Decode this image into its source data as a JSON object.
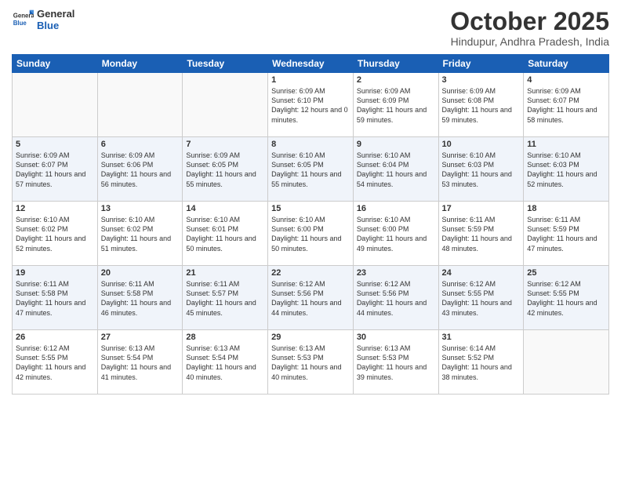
{
  "header": {
    "logo_general": "General",
    "logo_blue": "Blue",
    "month_title": "October 2025",
    "location": "Hindupur, Andhra Pradesh, India"
  },
  "calendar": {
    "days_of_week": [
      "Sunday",
      "Monday",
      "Tuesday",
      "Wednesday",
      "Thursday",
      "Friday",
      "Saturday"
    ],
    "weeks": [
      [
        {
          "date": "",
          "sunrise": "",
          "sunset": "",
          "daylight": ""
        },
        {
          "date": "",
          "sunrise": "",
          "sunset": "",
          "daylight": ""
        },
        {
          "date": "",
          "sunrise": "",
          "sunset": "",
          "daylight": ""
        },
        {
          "date": "1",
          "sunrise": "Sunrise: 6:09 AM",
          "sunset": "Sunset: 6:10 PM",
          "daylight": "Daylight: 12 hours and 0 minutes."
        },
        {
          "date": "2",
          "sunrise": "Sunrise: 6:09 AM",
          "sunset": "Sunset: 6:09 PM",
          "daylight": "Daylight: 11 hours and 59 minutes."
        },
        {
          "date": "3",
          "sunrise": "Sunrise: 6:09 AM",
          "sunset": "Sunset: 6:08 PM",
          "daylight": "Daylight: 11 hours and 59 minutes."
        },
        {
          "date": "4",
          "sunrise": "Sunrise: 6:09 AM",
          "sunset": "Sunset: 6:07 PM",
          "daylight": "Daylight: 11 hours and 58 minutes."
        }
      ],
      [
        {
          "date": "5",
          "sunrise": "Sunrise: 6:09 AM",
          "sunset": "Sunset: 6:07 PM",
          "daylight": "Daylight: 11 hours and 57 minutes."
        },
        {
          "date": "6",
          "sunrise": "Sunrise: 6:09 AM",
          "sunset": "Sunset: 6:06 PM",
          "daylight": "Daylight: 11 hours and 56 minutes."
        },
        {
          "date": "7",
          "sunrise": "Sunrise: 6:09 AM",
          "sunset": "Sunset: 6:05 PM",
          "daylight": "Daylight: 11 hours and 55 minutes."
        },
        {
          "date": "8",
          "sunrise": "Sunrise: 6:10 AM",
          "sunset": "Sunset: 6:05 PM",
          "daylight": "Daylight: 11 hours and 55 minutes."
        },
        {
          "date": "9",
          "sunrise": "Sunrise: 6:10 AM",
          "sunset": "Sunset: 6:04 PM",
          "daylight": "Daylight: 11 hours and 54 minutes."
        },
        {
          "date": "10",
          "sunrise": "Sunrise: 6:10 AM",
          "sunset": "Sunset: 6:03 PM",
          "daylight": "Daylight: 11 hours and 53 minutes."
        },
        {
          "date": "11",
          "sunrise": "Sunrise: 6:10 AM",
          "sunset": "Sunset: 6:03 PM",
          "daylight": "Daylight: 11 hours and 52 minutes."
        }
      ],
      [
        {
          "date": "12",
          "sunrise": "Sunrise: 6:10 AM",
          "sunset": "Sunset: 6:02 PM",
          "daylight": "Daylight: 11 hours and 52 minutes."
        },
        {
          "date": "13",
          "sunrise": "Sunrise: 6:10 AM",
          "sunset": "Sunset: 6:02 PM",
          "daylight": "Daylight: 11 hours and 51 minutes."
        },
        {
          "date": "14",
          "sunrise": "Sunrise: 6:10 AM",
          "sunset": "Sunset: 6:01 PM",
          "daylight": "Daylight: 11 hours and 50 minutes."
        },
        {
          "date": "15",
          "sunrise": "Sunrise: 6:10 AM",
          "sunset": "Sunset: 6:00 PM",
          "daylight": "Daylight: 11 hours and 50 minutes."
        },
        {
          "date": "16",
          "sunrise": "Sunrise: 6:10 AM",
          "sunset": "Sunset: 6:00 PM",
          "daylight": "Daylight: 11 hours and 49 minutes."
        },
        {
          "date": "17",
          "sunrise": "Sunrise: 6:11 AM",
          "sunset": "Sunset: 5:59 PM",
          "daylight": "Daylight: 11 hours and 48 minutes."
        },
        {
          "date": "18",
          "sunrise": "Sunrise: 6:11 AM",
          "sunset": "Sunset: 5:59 PM",
          "daylight": "Daylight: 11 hours and 47 minutes."
        }
      ],
      [
        {
          "date": "19",
          "sunrise": "Sunrise: 6:11 AM",
          "sunset": "Sunset: 5:58 PM",
          "daylight": "Daylight: 11 hours and 47 minutes."
        },
        {
          "date": "20",
          "sunrise": "Sunrise: 6:11 AM",
          "sunset": "Sunset: 5:58 PM",
          "daylight": "Daylight: 11 hours and 46 minutes."
        },
        {
          "date": "21",
          "sunrise": "Sunrise: 6:11 AM",
          "sunset": "Sunset: 5:57 PM",
          "daylight": "Daylight: 11 hours and 45 minutes."
        },
        {
          "date": "22",
          "sunrise": "Sunrise: 6:12 AM",
          "sunset": "Sunset: 5:56 PM",
          "daylight": "Daylight: 11 hours and 44 minutes."
        },
        {
          "date": "23",
          "sunrise": "Sunrise: 6:12 AM",
          "sunset": "Sunset: 5:56 PM",
          "daylight": "Daylight: 11 hours and 44 minutes."
        },
        {
          "date": "24",
          "sunrise": "Sunrise: 6:12 AM",
          "sunset": "Sunset: 5:55 PM",
          "daylight": "Daylight: 11 hours and 43 minutes."
        },
        {
          "date": "25",
          "sunrise": "Sunrise: 6:12 AM",
          "sunset": "Sunset: 5:55 PM",
          "daylight": "Daylight: 11 hours and 42 minutes."
        }
      ],
      [
        {
          "date": "26",
          "sunrise": "Sunrise: 6:12 AM",
          "sunset": "Sunset: 5:55 PM",
          "daylight": "Daylight: 11 hours and 42 minutes."
        },
        {
          "date": "27",
          "sunrise": "Sunrise: 6:13 AM",
          "sunset": "Sunset: 5:54 PM",
          "daylight": "Daylight: 11 hours and 41 minutes."
        },
        {
          "date": "28",
          "sunrise": "Sunrise: 6:13 AM",
          "sunset": "Sunset: 5:54 PM",
          "daylight": "Daylight: 11 hours and 40 minutes."
        },
        {
          "date": "29",
          "sunrise": "Sunrise: 6:13 AM",
          "sunset": "Sunset: 5:53 PM",
          "daylight": "Daylight: 11 hours and 40 minutes."
        },
        {
          "date": "30",
          "sunrise": "Sunrise: 6:13 AM",
          "sunset": "Sunset: 5:53 PM",
          "daylight": "Daylight: 11 hours and 39 minutes."
        },
        {
          "date": "31",
          "sunrise": "Sunrise: 6:14 AM",
          "sunset": "Sunset: 5:52 PM",
          "daylight": "Daylight: 11 hours and 38 minutes."
        },
        {
          "date": "",
          "sunrise": "",
          "sunset": "",
          "daylight": ""
        }
      ]
    ]
  }
}
